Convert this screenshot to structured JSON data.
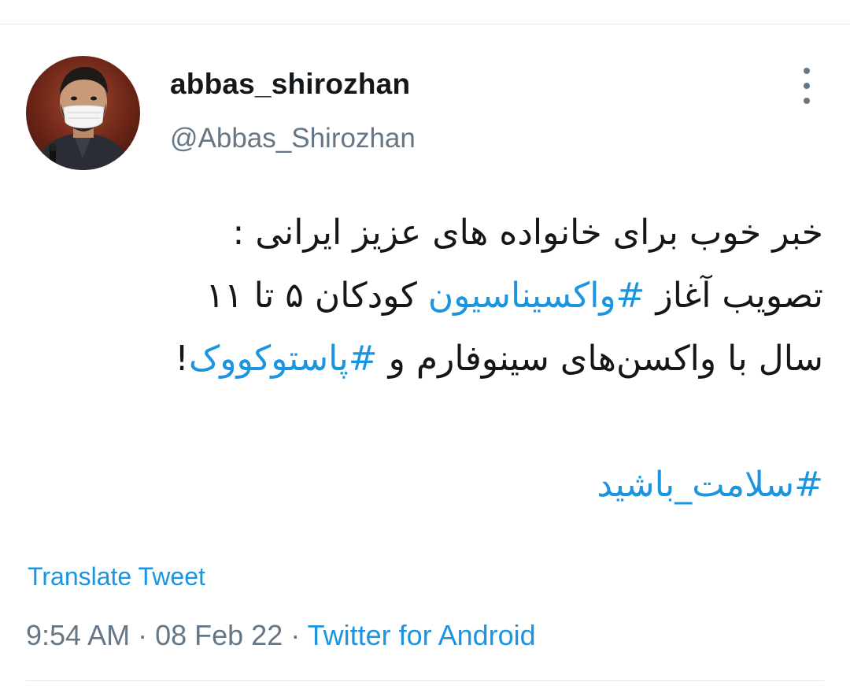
{
  "tweet": {
    "author": {
      "display_name": "abbas_shirozhan",
      "handle": "@Abbas_Shirozhan",
      "avatar": "profile-photo"
    },
    "more_icon": "more-vertical-icon",
    "body": {
      "line1": "خبر خوب برای خانواده های عزیز ایرانی :",
      "line2_prefix": "تصویب آغاز ",
      "line2_hashtag": "#واکسیناسیون",
      "line2_suffix": " کودکان ۵ تا ۱۱",
      "line3_prefix": "سال با واکسن‌های سینوفارم و ",
      "line3_hashtag": "#پاستوکووک",
      "line3_suffix": "!",
      "line5_hashtag": "#سلامت_باشید"
    },
    "translate_label": "Translate Tweet",
    "time": "9:54 AM",
    "separator1": " · ",
    "date": "08 Feb 22",
    "separator2": " · ",
    "source": "Twitter for Android"
  },
  "colors": {
    "link": "#1b95e0",
    "text": "#14171a",
    "secondary": "#657786",
    "divider": "#e3e6e8"
  }
}
